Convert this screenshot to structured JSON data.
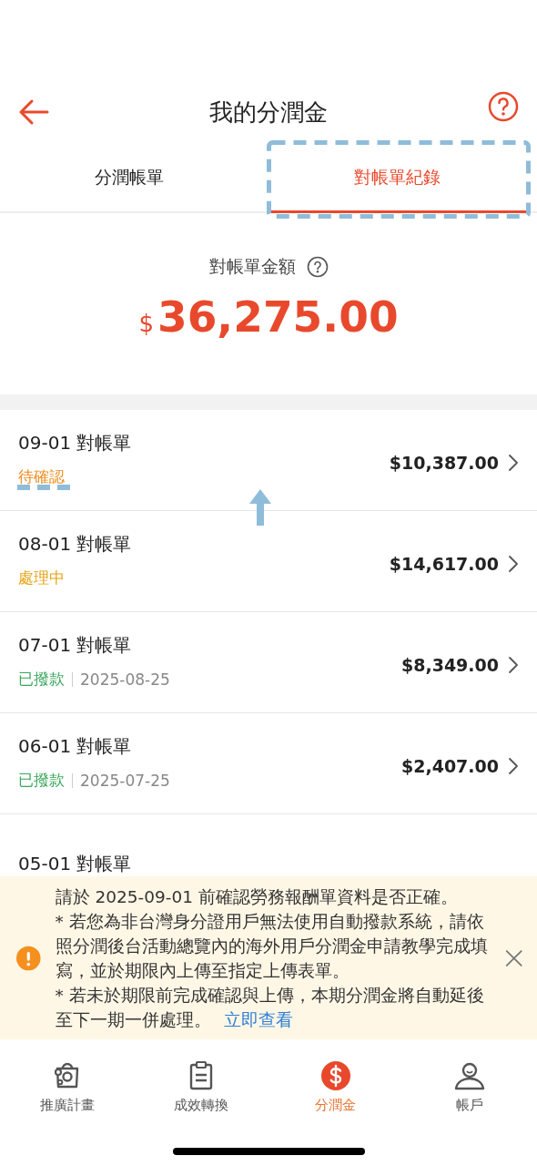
{
  "header": {
    "title": "我的分潤金"
  },
  "tabs": [
    {
      "label": "分潤帳單",
      "selected": false
    },
    {
      "label": "對帳單紀錄",
      "selected": true
    }
  ],
  "summary": {
    "label": "對帳單金額",
    "currency": "$",
    "amount": "36,275.00"
  },
  "statements": [
    {
      "title": "09-01 對帳單",
      "status": "待確認",
      "color": "#f08c1e",
      "amount": "$10,387.00"
    },
    {
      "title": "08-01 對帳單",
      "status": "處理中",
      "color": "#e6a417",
      "amount": "$14,617.00"
    },
    {
      "title": "07-01 對帳單",
      "status": "已撥款",
      "color": "#3aa65c",
      "date": "2025-08-25",
      "amount": "$8,349.00"
    },
    {
      "title": "06-01 對帳單",
      "status": "已撥款",
      "color": "#3aa65c",
      "date": "2025-07-25",
      "amount": "$2,407.00"
    },
    {
      "title": "05-01 對帳單"
    }
  ],
  "notice": {
    "lines": [
      "請於 2025-09-01 前確認勞務報酬單資料是否正確。",
      "* 若您為非台灣身分證用戶無法使用自動撥款系統，請依照分潤後台活動總覽內的海外用戶分潤金申請教學完成填寫，並於期限內上傳至指定上傳表單。",
      "* 若未於期限前完成確認與上傳，本期分潤金將自動延後至下一期一併處理。"
    ],
    "link": "立即查看"
  },
  "nav": [
    {
      "label": "推廣計畫",
      "kind": "promo",
      "selected": false
    },
    {
      "label": "成效轉換",
      "kind": "report",
      "selected": false
    },
    {
      "label": "分潤金",
      "kind": "money",
      "selected": true
    },
    {
      "label": "帳戶",
      "kind": "account",
      "selected": false
    }
  ]
}
